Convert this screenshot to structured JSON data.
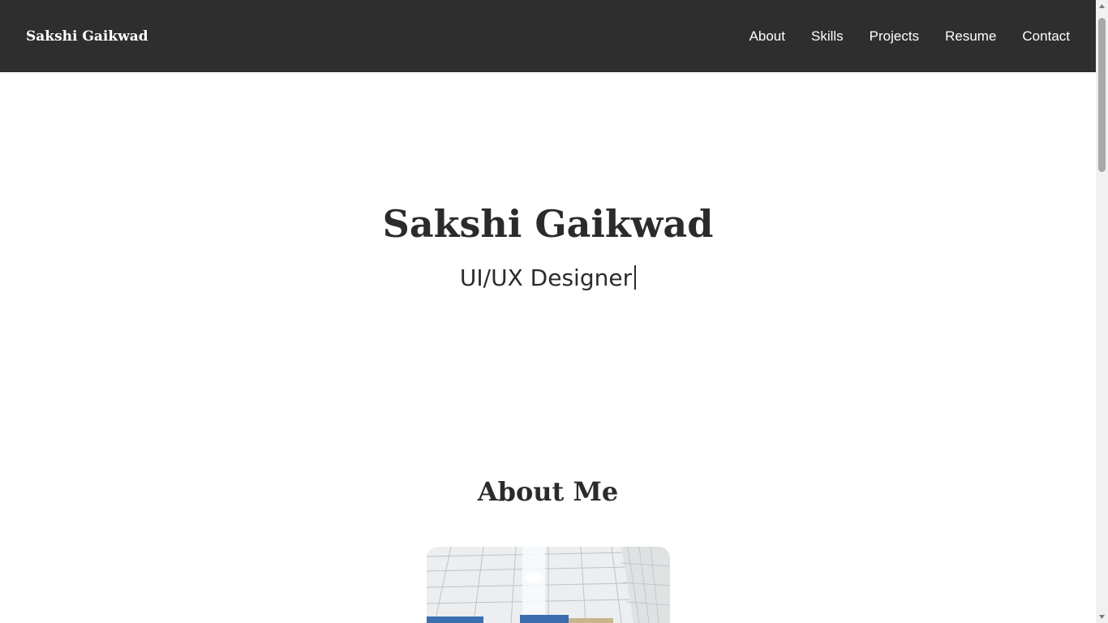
{
  "navbar": {
    "brand": "Sakshi Gaikwad",
    "links": [
      {
        "label": "About"
      },
      {
        "label": "Skills"
      },
      {
        "label": "Projects"
      },
      {
        "label": "Resume"
      },
      {
        "label": "Contact"
      }
    ],
    "background_color": "#2e2e2e",
    "text_color": "#ffffff"
  },
  "hero": {
    "title": "Sakshi Gaikwad",
    "subtitle": "UI/UX Designer"
  },
  "about": {
    "title": "About Me",
    "photo_icon": "profile-photo"
  },
  "colors": {
    "text": "#2b2b2b",
    "page_background": "#ffffff"
  }
}
